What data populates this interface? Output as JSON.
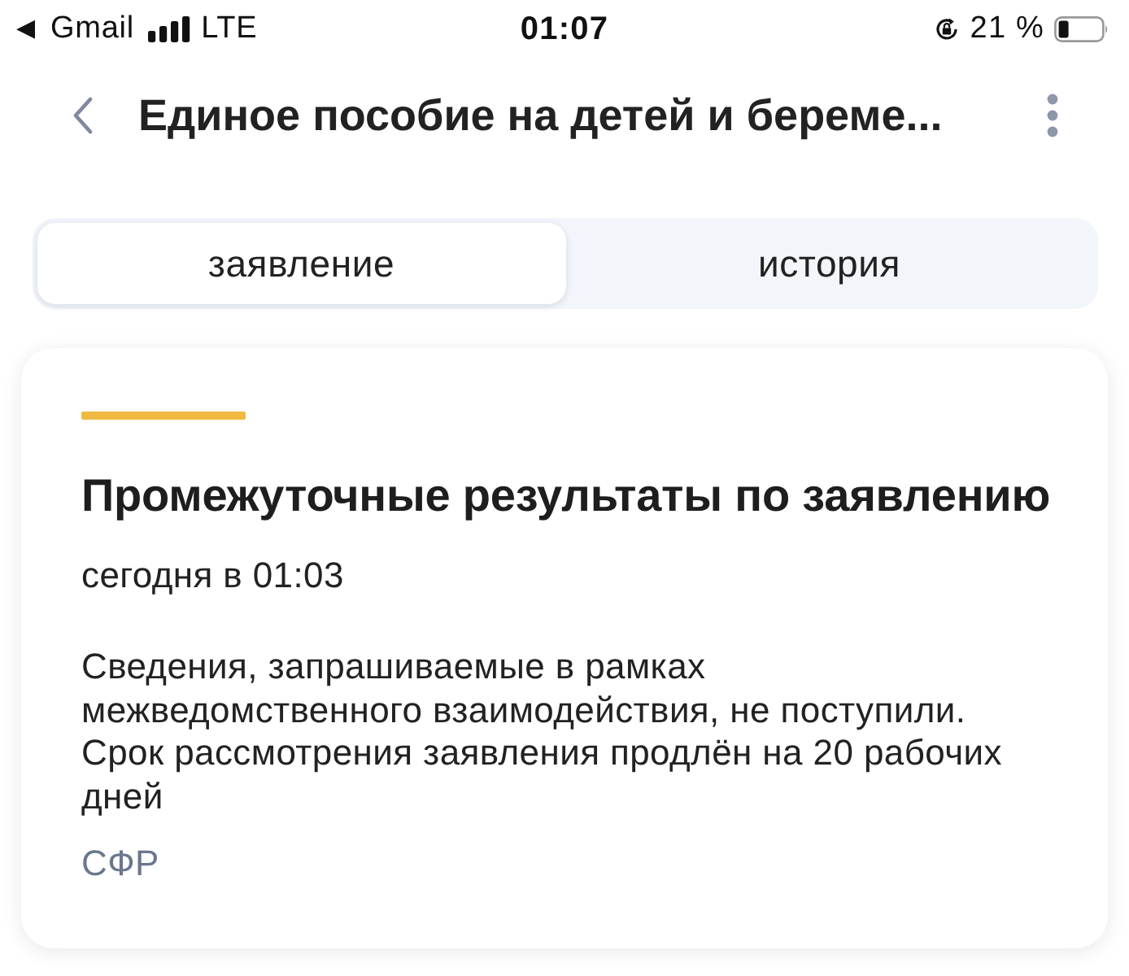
{
  "status_bar": {
    "back_arrow": "◀",
    "back_app": "Gmail",
    "network": "LTE",
    "time": "01:07",
    "battery_percent": "21 %"
  },
  "header": {
    "title": "Единое пособие на детей и береме..."
  },
  "tabs": [
    {
      "label": "заявление",
      "selected": true
    },
    {
      "label": "история",
      "selected": false
    }
  ],
  "card": {
    "title": "Промежуточные результаты по заявлению",
    "time": "сегодня в 01:03",
    "message": "Сведения, запрашиваемые в рамках межведомственного взаимодействия, не поступили. Срок рассмотрения заявления продлён на 20 рабочих дней",
    "source": "СФР"
  }
}
